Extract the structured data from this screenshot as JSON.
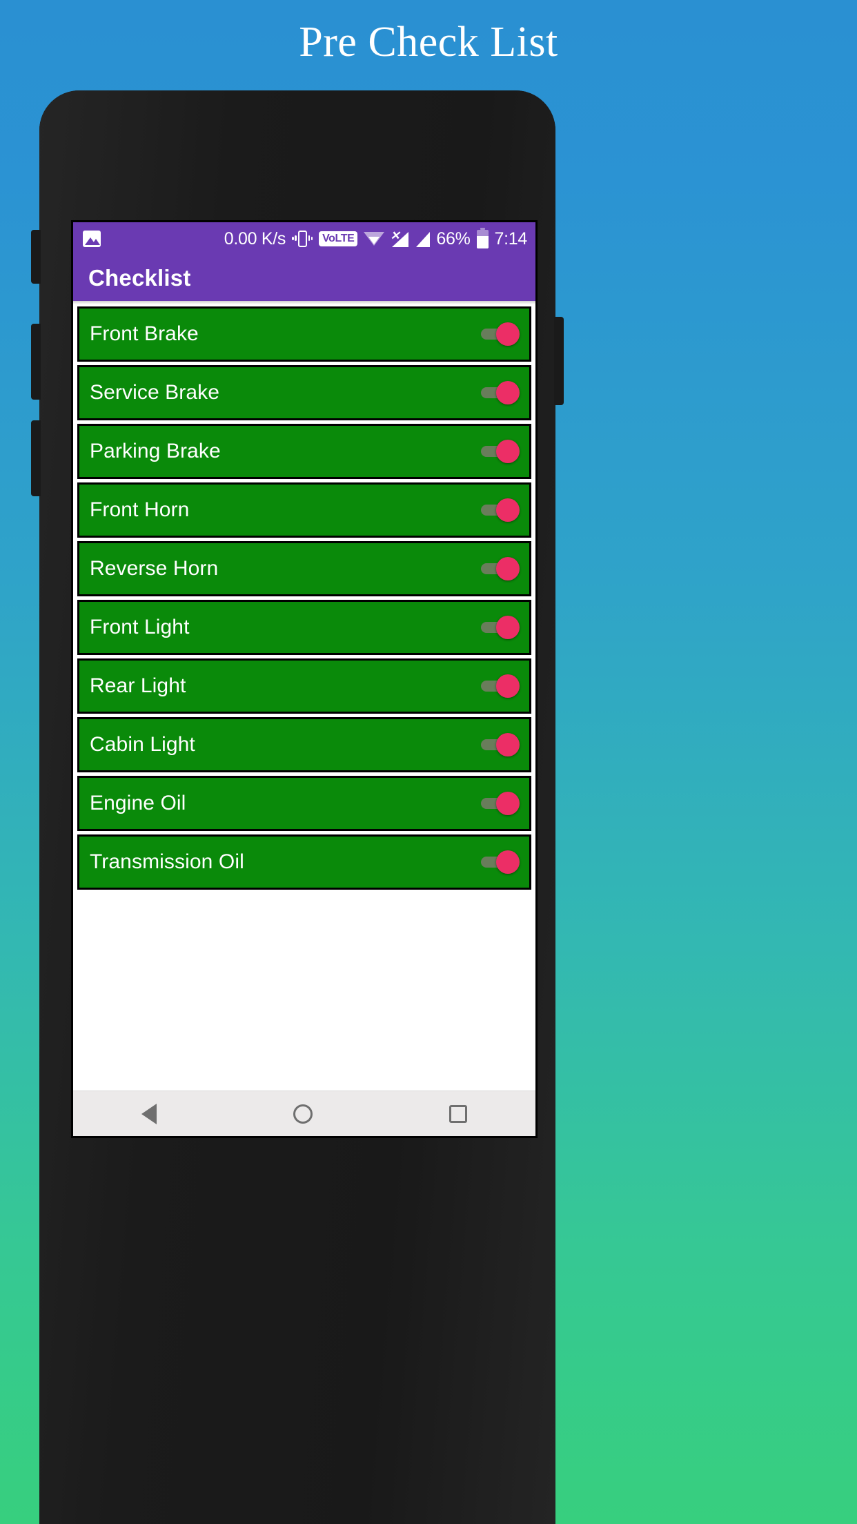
{
  "page": {
    "title": "Pre Check List",
    "background_top": "#2a90d2",
    "background_bottom": "#37cf7e"
  },
  "statusbar": {
    "network_speed": "0.00 K/s",
    "volte_label": "VoLTE",
    "battery_percent": "66%",
    "time": "7:14",
    "icons": {
      "notification": "image-icon",
      "vibrate": "vibrate-icon",
      "wifi": "wifi-icon",
      "signal_no_sim": "signal-no-sim-icon",
      "signal": "signal-icon",
      "battery": "battery-icon"
    },
    "background": "#6a3ab2"
  },
  "appbar": {
    "title": "Checklist",
    "background": "#6a3ab2"
  },
  "checklist": {
    "row_color": "#0a8a0a",
    "switch_on_color": "#ec2e66",
    "items": [
      {
        "label": "Front Brake",
        "checked": true
      },
      {
        "label": "Service Brake",
        "checked": true
      },
      {
        "label": "Parking Brake",
        "checked": true
      },
      {
        "label": "Front Horn",
        "checked": true
      },
      {
        "label": "Reverse Horn",
        "checked": true
      },
      {
        "label": "Front Light",
        "checked": true
      },
      {
        "label": "Rear Light",
        "checked": true
      },
      {
        "label": "Cabin Light",
        "checked": true
      },
      {
        "label": "Engine Oil",
        "checked": true
      },
      {
        "label": "Transmission Oil",
        "checked": true
      }
    ]
  },
  "navbar": {
    "back": "back-icon",
    "home": "home-icon",
    "recents": "recents-icon"
  }
}
